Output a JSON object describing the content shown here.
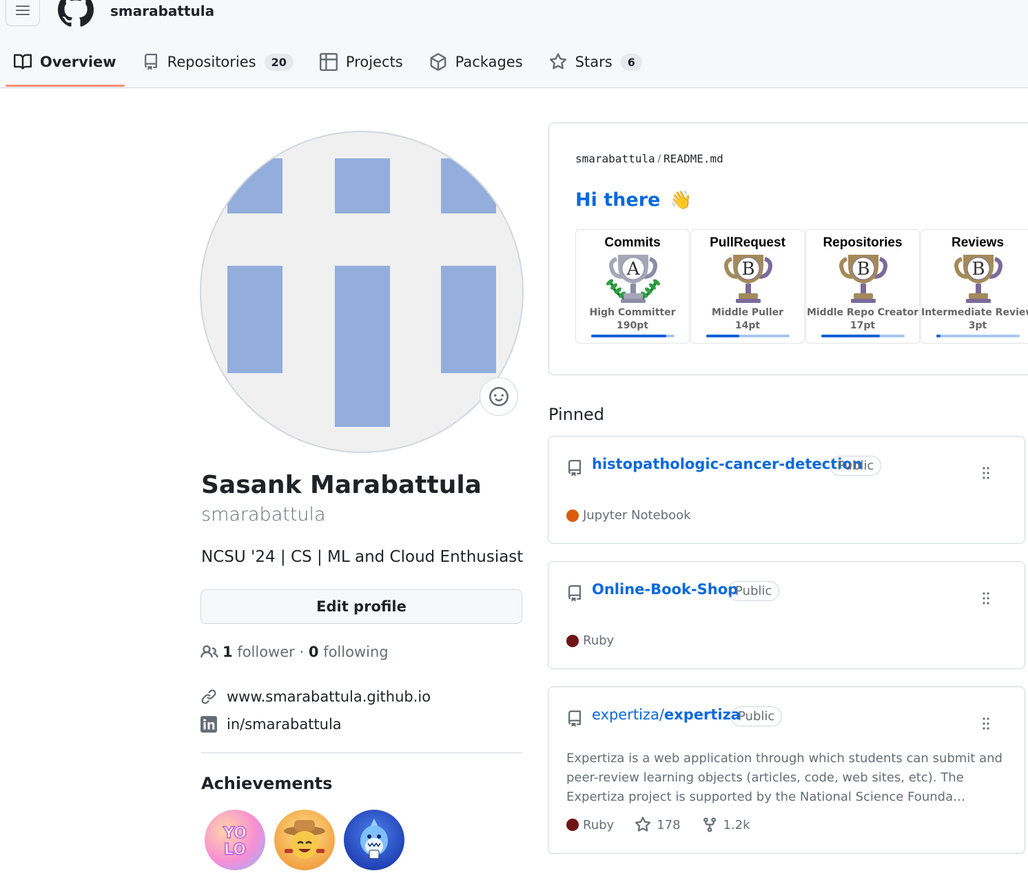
{
  "header": {
    "username": "smarabattula",
    "tabs": [
      {
        "label": "Overview",
        "icon": "book-icon",
        "active": true
      },
      {
        "label": "Repositories",
        "icon": "repo-icon",
        "count": "20"
      },
      {
        "label": "Projects",
        "icon": "table-icon"
      },
      {
        "label": "Packages",
        "icon": "package-icon"
      },
      {
        "label": "Stars",
        "icon": "star-icon",
        "count": "6"
      }
    ]
  },
  "profile": {
    "full_name": "Sasank Marabattula",
    "login": "smarabattula",
    "bio": "NCSU '24 | CS | ML and Cloud Enthusiast",
    "edit_label": "Edit profile",
    "followers_count": "1",
    "followers_label": "follower",
    "separator": "·",
    "following_count": "0",
    "following_label": "following",
    "website": "www.smarabattula.github.io",
    "linkedin": "in/smarabattula",
    "achievements_title": "Achievements",
    "achievement_badges": [
      "yolo",
      "quickdraw",
      "pull-shark"
    ]
  },
  "readme": {
    "owner": "smarabattula",
    "separator": "/",
    "file": "README.md",
    "heading": "Hi there",
    "wave": "👋",
    "trophies": [
      {
        "title": "Commits",
        "rank": "A",
        "rank_name": "High Committer",
        "points": "190pt",
        "progress": 0.9,
        "laurel": true
      },
      {
        "title": "PullRequest",
        "rank": "B",
        "rank_name": "Middle Puller",
        "points": "14pt",
        "progress": 0.4,
        "laurel": false
      },
      {
        "title": "Repositories",
        "rank": "B",
        "rank_name": "Middle Repo Creator",
        "points": "17pt",
        "progress": 0.7,
        "laurel": false
      },
      {
        "title": "Reviews",
        "rank": "B",
        "rank_name": "Intermediate Reviewer",
        "points": "3pt",
        "progress": 0.05,
        "laurel": false
      }
    ]
  },
  "pinned": {
    "label": "Pinned",
    "repos": [
      {
        "owner": "",
        "name": "histopathologic-cancer-detection",
        "visibility": "Public",
        "description": "",
        "language": "Jupyter Notebook",
        "lang_color": "#DA5B0B",
        "stars": "",
        "forks": ""
      },
      {
        "owner": "",
        "name": "Online-Book-Shop",
        "visibility": "Public",
        "description": "",
        "language": "Ruby",
        "lang_color": "#701516",
        "stars": "",
        "forks": ""
      },
      {
        "owner": "expertiza/",
        "name": "expertiza",
        "visibility": "Public",
        "description": "Expertiza is a web application through which students can submit and peer-review learning objects (articles, code, web sites, etc). The Expertiza project is supported by the National Science Founda…",
        "language": "Ruby",
        "lang_color": "#701516",
        "stars": "178",
        "forks": "1.2k"
      }
    ]
  }
}
